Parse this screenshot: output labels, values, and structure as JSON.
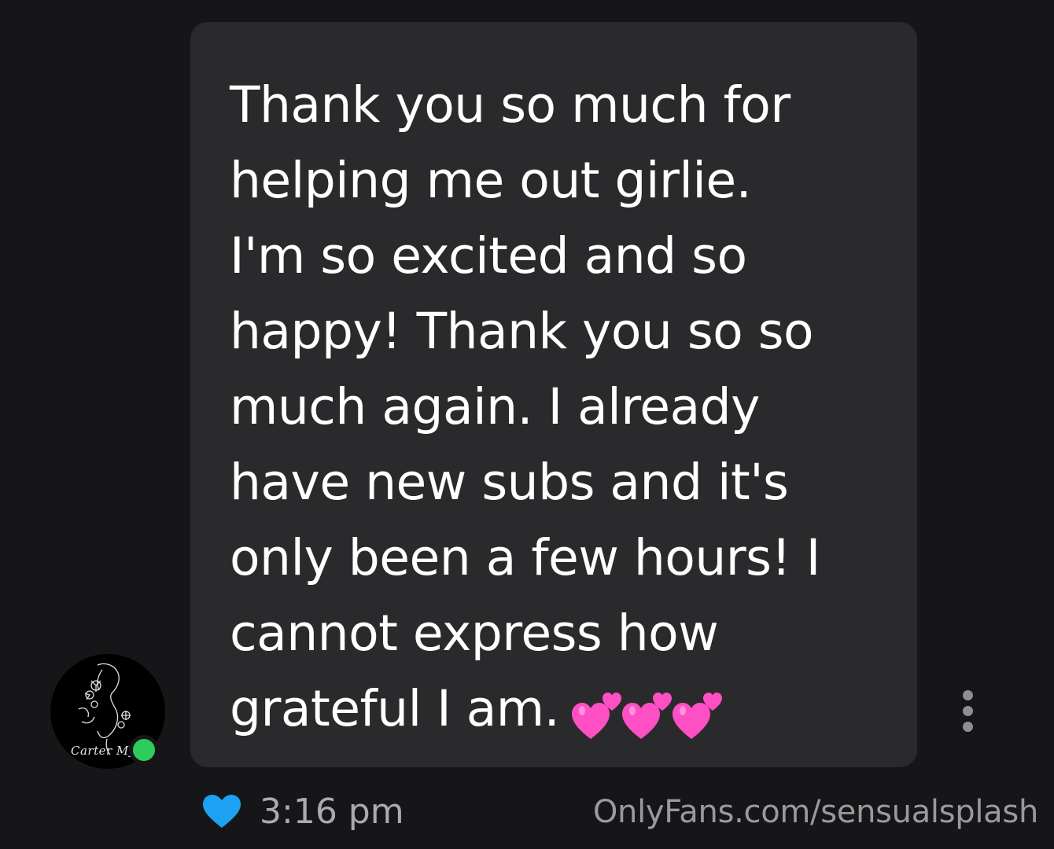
{
  "message": {
    "lines": [
      "Thank you so much for",
      "helping me out girlie.",
      "I'm so excited and so",
      "happy! Thank you so so",
      "much again. I already",
      "have new subs and it's",
      "only been a few hours! I",
      "cannot express how",
      "grateful I am."
    ],
    "emoji_icons": [
      "two-hearts-icon",
      "two-hearts-icon",
      "two-hearts-icon"
    ],
    "emoji_color": "#ff4fc4"
  },
  "sender": {
    "avatar_signature": "Carter Mya",
    "online": true,
    "online_color": "#2ecc5a"
  },
  "meta": {
    "time": "3:16 pm",
    "liked": true,
    "like_color": "#1da1f2"
  },
  "watermark": "OnlyFans.com/sensualsplash",
  "theme": {
    "background": "#161618",
    "bubble": "#2a2a2c",
    "text": "#ffffff",
    "muted_text": "#a9abb0"
  }
}
